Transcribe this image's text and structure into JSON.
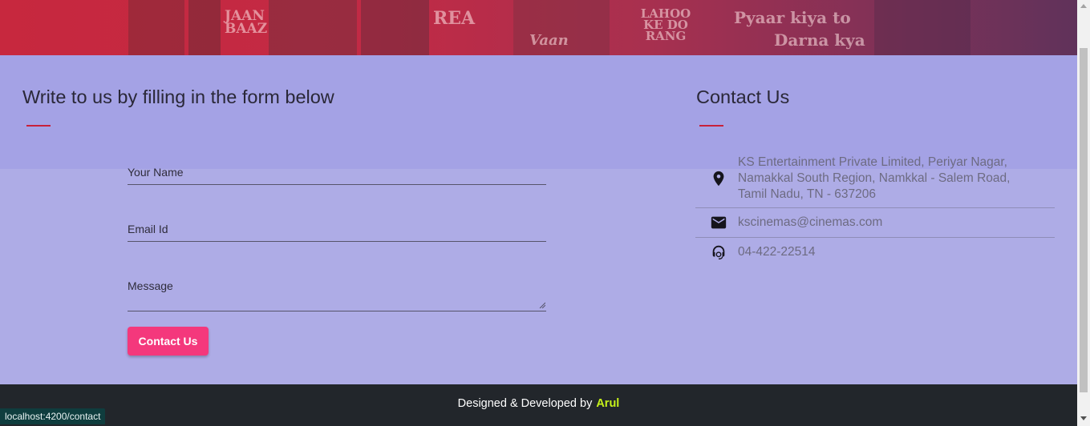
{
  "hero": {
    "poster_texts": [
      "JAAN BAAZ",
      "REA",
      "Vaan",
      "LAHOO KE DO RANG",
      "Pyaar kiya to",
      "Darna kya"
    ]
  },
  "form_section": {
    "title": "Write to us by filling in the form below",
    "fields": {
      "name": {
        "label": "Your Name",
        "value": ""
      },
      "email": {
        "label": "Email Id",
        "value": ""
      },
      "message": {
        "label": "Message",
        "value": ""
      }
    },
    "submit_label": "Contact Us"
  },
  "contact_section": {
    "title": "Contact Us",
    "items": [
      {
        "icon": "location-pin-icon",
        "lines": [
          "KS Entertainment Private Limited, Periyar Nagar,",
          "Namakkal South Region, Namkkal - Salem Road,",
          "Tamil Nadu, TN - 637206"
        ]
      },
      {
        "icon": "mail-icon",
        "text": "kscinemas@cinemas.com"
      },
      {
        "icon": "headset-icon",
        "text": "04-422-22514"
      }
    ]
  },
  "footer": {
    "text": "Designed & Developed by",
    "author": "Arul"
  },
  "status_bar": {
    "url": "localhost:4200/contact"
  },
  "colors": {
    "accent": "#c8203a",
    "button": "#f4387c",
    "page_background": "#aeace6",
    "footer_background": "#22262b",
    "author_highlight": "#c6f21a"
  }
}
